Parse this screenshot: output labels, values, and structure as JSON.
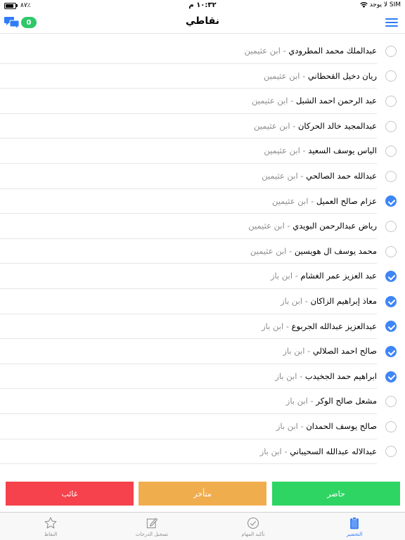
{
  "status_bar": {
    "battery_pct": "٨٧٪",
    "battery_level": 0.87,
    "time": "١٠:٣٢ م",
    "carrier": "لا يوجد SIM"
  },
  "nav": {
    "title": "نقاطي",
    "chat_badge": "0",
    "chat_icon": "chat-bubbles-icon",
    "menu_icon": "hamburger-menu-icon",
    "accent_color": "#2f7cf6"
  },
  "students": [
    {
      "name": "عبدالملك محمد المطرودي",
      "separator": " - ",
      "school": "ابن عثيمين",
      "checked": false
    },
    {
      "name": "ريان دخيل القحطاني",
      "separator": " - ",
      "school": "ابن عثيمين",
      "checked": false
    },
    {
      "name": "عبد الرحمن احمد الشبل",
      "separator": " - ",
      "school": "ابن عثيمين",
      "checked": false
    },
    {
      "name": "عبدالمجيد خالد الحركان",
      "separator": " - ",
      "school": "ابن عثيمين",
      "checked": false
    },
    {
      "name": "الياس يوسف السعيد",
      "separator": " - ",
      "school": "ابن عثيمين",
      "checked": false
    },
    {
      "name": "عبدالله حمد الصالحي",
      "separator": " - ",
      "school": "ابن عثيمين",
      "checked": false
    },
    {
      "name": "عزام صالح العميل",
      "separator": " - ",
      "school": "ابن عثيمين",
      "checked": true
    },
    {
      "name": "رياض عبدالرحمن البويدي",
      "separator": " - ",
      "school": "ابن عثيمين",
      "checked": false
    },
    {
      "name": "محمد يوسف ال هويسين",
      "separator": " - ",
      "school": "ابن عثيمين",
      "checked": false
    },
    {
      "name": "عبد العزيز عمر الغشام",
      "separator": " - ",
      "school": "ابن باز",
      "checked": true
    },
    {
      "name": "معاذ إبراهيم الزاكان",
      "separator": " - ",
      "school": "ابن باز",
      "checked": true
    },
    {
      "name": "عبدالعزيز عبدالله الجربوع",
      "separator": " - ",
      "school": "ابن باز",
      "checked": true
    },
    {
      "name": "صالح احمد الصلالي",
      "separator": " - ",
      "school": "ابن باز",
      "checked": true
    },
    {
      "name": "ابراهيم حمد الجخيدب",
      "separator": " - ",
      "school": "ابن باز",
      "checked": true
    },
    {
      "name": "مشعل صالح الوكر",
      "separator": " - ",
      "school": "ابن باز",
      "checked": false
    },
    {
      "name": "صالح يوسف الحمدان",
      "separator": " - ",
      "school": "ابن باز",
      "checked": false
    },
    {
      "name": "عبدالاله عبدالله السحيباني",
      "separator": " - ",
      "school": "ابن باز",
      "checked": false
    }
  ],
  "actions": {
    "absent": "غائب",
    "late": "متأخر",
    "present": "حاضر",
    "absent_color": "#f5424c",
    "late_color": "#f0ad4e",
    "present_color": "#2fd563"
  },
  "tabs": [
    {
      "label": "النقاط",
      "icon": "star-icon",
      "active": false
    },
    {
      "label": "تسجيل الدرجات",
      "icon": "edit-icon",
      "active": false
    },
    {
      "label": "تأكيد المهام",
      "icon": "checkmark-circle-icon",
      "active": false
    },
    {
      "label": "التحضير",
      "icon": "clipboard-icon",
      "active": true
    }
  ]
}
